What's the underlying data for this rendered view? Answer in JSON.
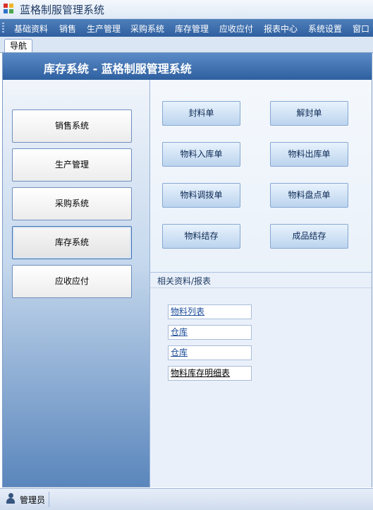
{
  "window": {
    "title": "蓝格制服管理系统"
  },
  "menu": [
    "基础资料",
    "销售",
    "生产管理",
    "采购系统",
    "库存管理",
    "应收应付",
    "报表中心",
    "系统设置",
    "窗口"
  ],
  "tab": {
    "label": "导航"
  },
  "header": {
    "title": "库存系统 - 蓝格制服管理系统"
  },
  "nav": [
    "销售系统",
    "生产管理",
    "采购系统",
    "库存系统",
    "应收应付"
  ],
  "nav_active": "库存系统",
  "actions": [
    "封料单",
    "解封单",
    "物料入库单",
    "物料出库单",
    "物料调拨单",
    "物料盘点单",
    "物料结存",
    "成品结存"
  ],
  "reports": {
    "title": "相关资料/报表",
    "links": [
      "物料列表",
      "仓库",
      "仓库",
      "物料库存明细表"
    ]
  },
  "status": {
    "user": "管理员"
  },
  "icons": {
    "app": "app-icon",
    "user": "user-icon"
  },
  "colors": {
    "header": "#3a6cab",
    "menubar": "#3f6fae",
    "accent": "#2e5f9f"
  }
}
